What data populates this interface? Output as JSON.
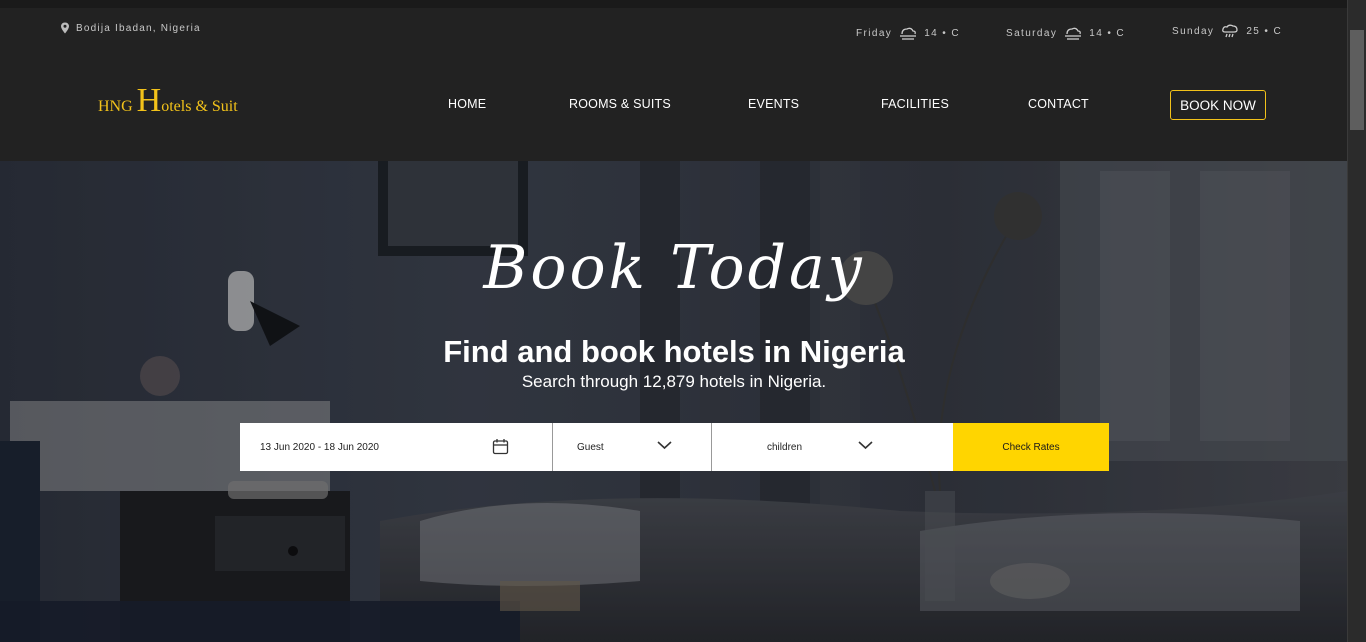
{
  "location": {
    "text": "Bodija Ibadan, Nigeria",
    "icon": "map-pin-icon"
  },
  "weather": [
    {
      "day": "Friday",
      "temp": "14 • C",
      "icon": "cloud-fog-icon"
    },
    {
      "day": "Saturday",
      "temp": "14 • C",
      "icon": "cloud-fog-icon"
    },
    {
      "day": "Sunday",
      "temp": "25 • C",
      "icon": "cloud-rain-icon"
    }
  ],
  "logo": {
    "part1": "HNG",
    "part2": "H",
    "part3": "otels & Suit",
    "color": "#f2c21a"
  },
  "nav": {
    "items": [
      "HOME",
      "ROOMS & SUITS",
      "EVENTS",
      "FACILITIES",
      "CONTACT"
    ],
    "book_now": "BOOK NOW"
  },
  "hero": {
    "script_title": "Book Today",
    "title": "Find and book hotels in Nigeria",
    "subtitle": "Search through 12,879 hotels in Nigeria."
  },
  "search": {
    "dates": "13 Jun 2020 - 18 Jun 2020",
    "guest": "Guest",
    "children": "children",
    "check_rates": "Check Rates",
    "accent": "#ffd500"
  }
}
